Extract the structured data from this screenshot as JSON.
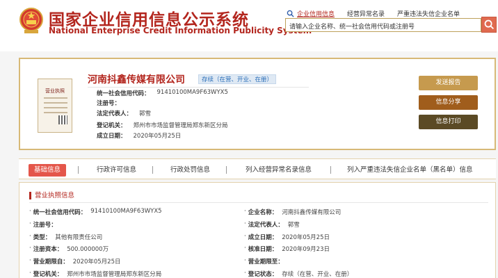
{
  "header": {
    "title_cn": "国家企业信用信息公示系统",
    "title_en": "National Enterprise Credit Information Publicity System",
    "search_tabs": [
      "企业信用信息",
      "经营异常名录",
      "严重违法失信企业名单"
    ],
    "search_placeholder": "请输入企业名称、统一社会信用代码或注册号"
  },
  "company": {
    "license_label": "营业执照",
    "name": "河南抖鑫传媒有限公司",
    "status": "存续（在营、开业、在册）",
    "rows": [
      {
        "label": "统一社会信用代码：",
        "value": "91410100MA9F63WYX5"
      },
      {
        "label": "注册号：",
        "value": ""
      },
      {
        "label": "法定代表人：",
        "value": "郭雪"
      },
      {
        "label": "登记机关：",
        "value": "郑州市市场监督管理局郑东新区分局"
      },
      {
        "label": "成立日期：",
        "value": "2020年05月25日"
      }
    ],
    "buttons": {
      "report": "发送报告",
      "share": "信息分享",
      "print": "信息打印"
    }
  },
  "tabs": [
    "基础信息",
    "行政许可信息",
    "行政处罚信息",
    "列入经营异常名录信息",
    "列入严重违法失信企业名单（黑名单）信息"
  ],
  "details": {
    "section_title": "营业执照信息",
    "left": [
      {
        "label": "统一社会信用代码：",
        "value": "91410100MA9F63WYX5"
      },
      {
        "label": "注册号：",
        "value": ""
      },
      {
        "label": "类型：",
        "value": "其他有限责任公司"
      },
      {
        "label": "注册资本：",
        "value": "500.000000万"
      },
      {
        "label": "营业期限自：",
        "value": "2020年05月25日"
      },
      {
        "label": "登记机关：",
        "value": "郑州市市场监督管理局郑东新区分局"
      }
    ],
    "right": [
      {
        "label": "企业名称：",
        "value": "河南抖鑫传媒有限公司"
      },
      {
        "label": "法定代表人：",
        "value": "郭雪"
      },
      {
        "label": "成立日期：",
        "value": "2020年05月25日"
      },
      {
        "label": "核准日期：",
        "value": "2020年09月23日"
      },
      {
        "label": "营业期限至：",
        "value": ""
      },
      {
        "label": "登记状态：",
        "value": "存续（在营、开业、在册）"
      }
    ]
  },
  "colors": {
    "brand_red": "#b3261e",
    "gold_border": "#d7b976",
    "search_btn": "#e06a4f"
  }
}
